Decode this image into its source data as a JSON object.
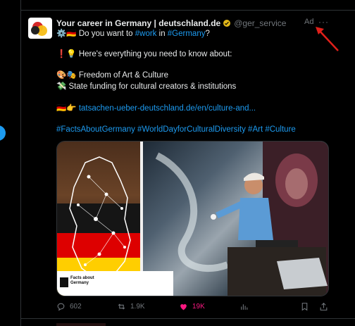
{
  "tweet": {
    "author_name": "Your career in Germany | deutschland.de",
    "handle": "@ger_service",
    "ad_label": "Ad",
    "more_label": "···",
    "lines": [
      {
        "prefix": "⚙️🇩🇪 Do you want to ",
        "tag1": "#work",
        "mid": " in ",
        "tag2": "#Germany",
        "suffix": "?"
      },
      {
        "text": "❗💡 Here's everything you need to know about:"
      },
      {
        "text": "🎨🎭 Freedom of Art & Culture"
      },
      {
        "text": "💸 State funding for cultural creators & institutions"
      },
      {
        "emoji": "🇩🇪👉 ",
        "link": "tatsachen-ueber-deutschland.de/en/culture-and..."
      },
      {
        "hashtags": "#FactsAboutGermany #WorldDayforCulturalDiversity #Art #Culture"
      }
    ],
    "media": {
      "badge_text": "Facts about Germany"
    },
    "actions": {
      "replies": "602",
      "retweets": "1.9K",
      "likes": "19K"
    }
  },
  "colors": {
    "background": "#000000",
    "link": "#1d9bf0",
    "muted": "#71767b",
    "like": "#f91880",
    "annotation_arrow": "#e0201a"
  },
  "icons": [
    "verified-badge-icon",
    "more-icon",
    "reply-icon",
    "retweet-icon",
    "like-icon",
    "analytics-icon",
    "bookmark-icon",
    "share-icon"
  ]
}
